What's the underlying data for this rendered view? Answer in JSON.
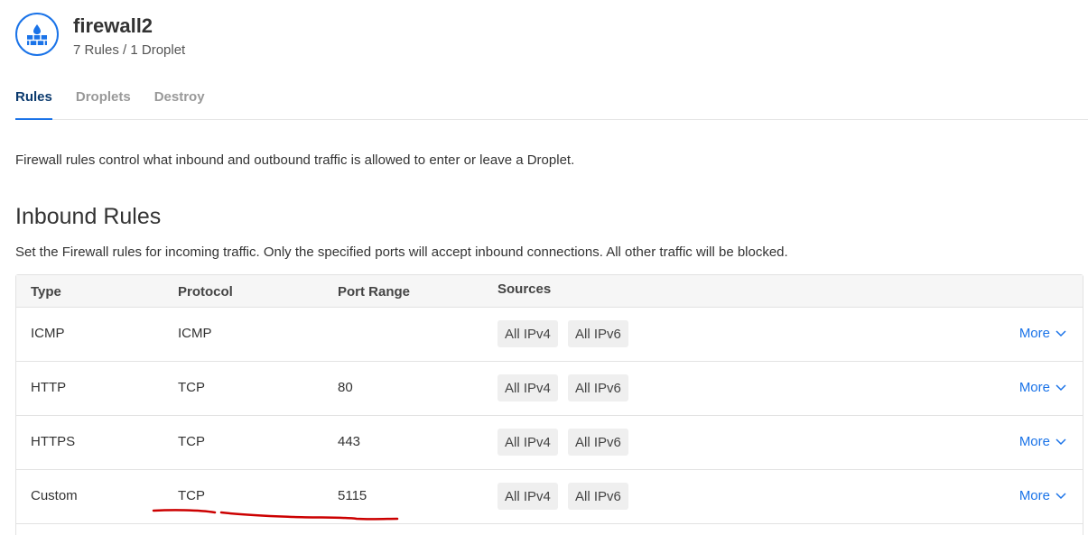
{
  "firewall": {
    "name": "firewall2",
    "summary": "7 Rules / 1 Droplet"
  },
  "tabs": [
    {
      "label": "Rules",
      "active": true
    },
    {
      "label": "Droplets",
      "active": false
    },
    {
      "label": "Destroy",
      "active": false
    }
  ],
  "description": "Firewall rules control what inbound and outbound traffic is allowed to enter or leave a Droplet.",
  "inbound": {
    "title": "Inbound Rules",
    "description": "Set the Firewall rules for incoming traffic. Only the specified ports will accept inbound connections. All other traffic will be blocked.",
    "headers": {
      "type": "Type",
      "protocol": "Protocol",
      "port_range": "Port Range",
      "sources": "Sources"
    },
    "rows": [
      {
        "type": "ICMP",
        "protocol": "ICMP",
        "port_range": "",
        "sources": [
          "All IPv4",
          "All IPv6"
        ],
        "more": "More"
      },
      {
        "type": "HTTP",
        "protocol": "TCP",
        "port_range": "80",
        "sources": [
          "All IPv4",
          "All IPv6"
        ],
        "more": "More"
      },
      {
        "type": "HTTPS",
        "protocol": "TCP",
        "port_range": "443",
        "sources": [
          "All IPv4",
          "All IPv6"
        ],
        "more": "More"
      },
      {
        "type": "Custom",
        "protocol": "TCP",
        "port_range": "5115",
        "sources": [
          "All IPv4",
          "All IPv6"
        ],
        "more": "More"
      }
    ]
  },
  "colors": {
    "accent": "#1a73e8",
    "annotation": "#cc0000"
  },
  "icons": {
    "firewall": "firewall-icon",
    "chevron": "chevron-down-icon"
  }
}
